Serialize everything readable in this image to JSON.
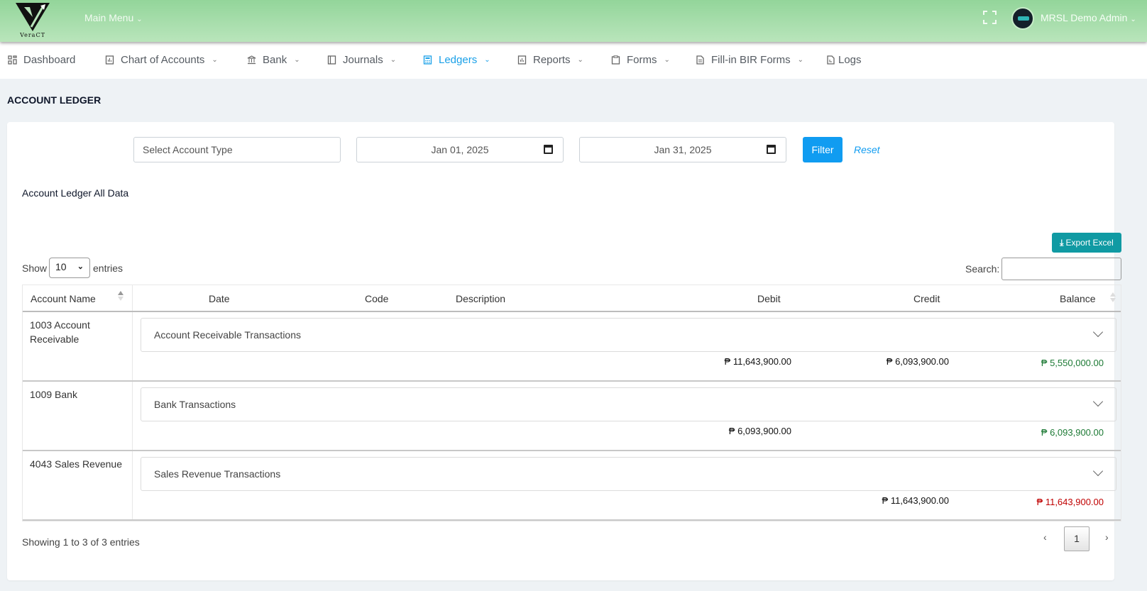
{
  "header": {
    "logo_text": "VeraCT",
    "main_menu_label": "Main Menu",
    "user_name": "MRSL Demo Admin"
  },
  "nav": {
    "items": [
      {
        "label": "Dashboard",
        "icon": "dashboard-icon",
        "dropdown": false,
        "active": false
      },
      {
        "label": "Chart of Accounts",
        "icon": "chart-doc-icon",
        "dropdown": true,
        "active": false
      },
      {
        "label": "Bank",
        "icon": "bank-icon",
        "dropdown": true,
        "active": false
      },
      {
        "label": "Journals",
        "icon": "journal-icon",
        "dropdown": true,
        "active": false
      },
      {
        "label": "Ledgers",
        "icon": "calculator-icon",
        "dropdown": true,
        "active": true
      },
      {
        "label": "Reports",
        "icon": "report-icon",
        "dropdown": true,
        "active": false
      },
      {
        "label": "Forms",
        "icon": "clipboard-icon",
        "dropdown": true,
        "active": false
      },
      {
        "label": "Fill-in BIR Forms",
        "icon": "form-file-icon",
        "dropdown": true,
        "active": false
      },
      {
        "label": "Logs",
        "icon": "log-file-icon",
        "dropdown": false,
        "active": false
      }
    ]
  },
  "page": {
    "title": "ACCOUNT LEDGER",
    "subtitle": "Account Ledger All Data"
  },
  "filters": {
    "account_type_placeholder": "Select Account Type",
    "date_from": "Jan 01, 2025",
    "date_to": "Jan 31, 2025",
    "filter_label": "Filter",
    "reset_label": "Reset"
  },
  "table_controls": {
    "export_label": "Export Excel",
    "show_label": "Show",
    "page_length": "10",
    "entries_label": "entries",
    "search_label": "Search:",
    "search_value": ""
  },
  "table": {
    "columns": [
      "Account Name",
      "Date",
      "Code",
      "Description",
      "Debit",
      "Credit",
      "Balance"
    ],
    "rows": [
      {
        "account": "1003 Account Receivable",
        "group_label": "Account Receivable Transactions",
        "debit": "₱ 11,643,900.00",
        "credit": "₱ 6,093,900.00",
        "balance": "₱ 5,550,000.00",
        "balance_status": "positive"
      },
      {
        "account": "1009 Bank",
        "group_label": "Bank Transactions",
        "debit": "₱ 6,093,900.00",
        "credit": "",
        "balance": "₱ 6,093,900.00",
        "balance_status": "positive"
      },
      {
        "account": "4043 Sales Revenue",
        "group_label": "Sales Revenue Transactions",
        "debit": "",
        "credit": "₱ 11,643,900.00",
        "balance": "₱ 11,643,900.00",
        "balance_status": "negative"
      }
    ]
  },
  "footer": {
    "info": "Showing 1 to 3 of 3 entries",
    "prev": "‹",
    "current_page": "1",
    "next": "›"
  },
  "colors": {
    "accent": "#109cf1",
    "export": "#109aa3",
    "positive": "#1d7a35",
    "negative": "#c00000",
    "header_gradient_top": "#93d59a"
  }
}
